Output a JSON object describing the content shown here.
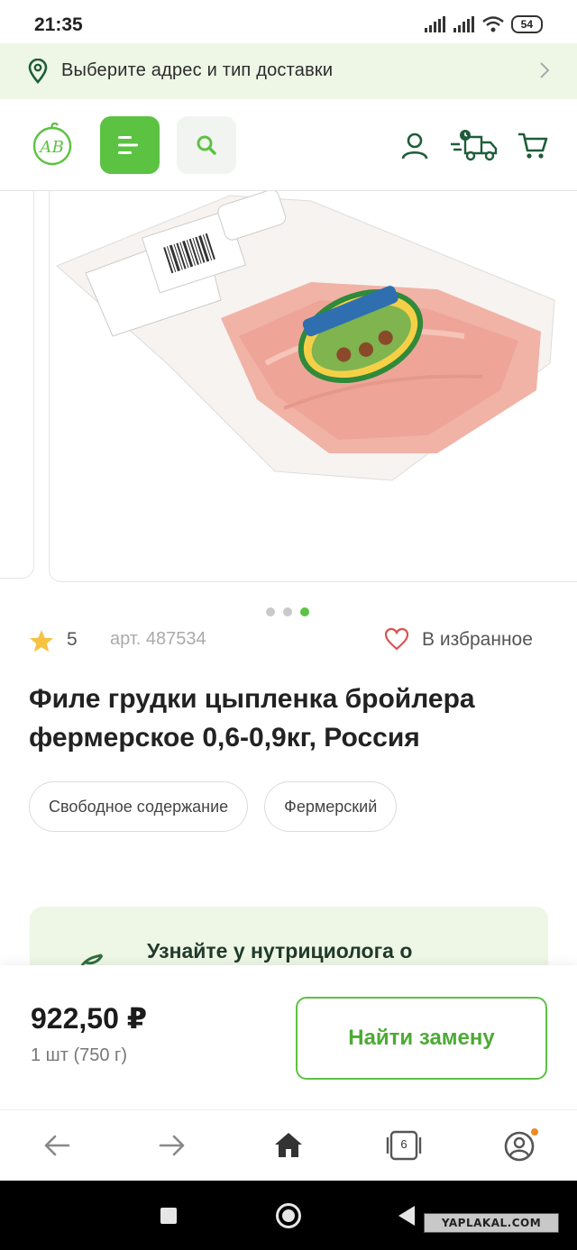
{
  "status_bar": {
    "time": "21:35",
    "battery": "54",
    "icons": [
      "signal-icon",
      "signal-icon",
      "wifi-icon",
      "battery-icon"
    ]
  },
  "delivery_bar": {
    "text": "Выберите адрес и тип доставки",
    "icon": "location-pin-icon",
    "chevron": "chevron-right-icon"
  },
  "header": {
    "logo_text": "АВ",
    "icons": [
      "menu-icon",
      "search-icon",
      "user-icon",
      "delivery-truck-icon",
      "cart-icon"
    ]
  },
  "gallery": {
    "slides": 3,
    "active_slide": 3
  },
  "product": {
    "rating": "5",
    "article": "арт. 487534",
    "favorite_label": "В избранное",
    "title": "Филе грудки цыпленка бройлера фермерское 0,6-0,9кг, Россия",
    "tags": [
      "Свободное содержание",
      "Фермерский"
    ]
  },
  "nutritionist": {
    "text": "Узнайте у нутрициолога о"
  },
  "purchase": {
    "price": "922,50 ₽",
    "quantity": "1 шт (750 г)",
    "replace_button": "Найти замену"
  },
  "browser_nav": {
    "tabs_count": "6",
    "icons": [
      "back-arrow-icon",
      "forward-arrow-icon",
      "home-icon",
      "tabs-icon",
      "profile-icon"
    ]
  },
  "system_nav": {
    "watermark": "YAPLAKAL.COM"
  },
  "colors": {
    "accent": "#5cc242",
    "light_green": "#eef6e6",
    "dark_green": "#1f5d3a"
  }
}
